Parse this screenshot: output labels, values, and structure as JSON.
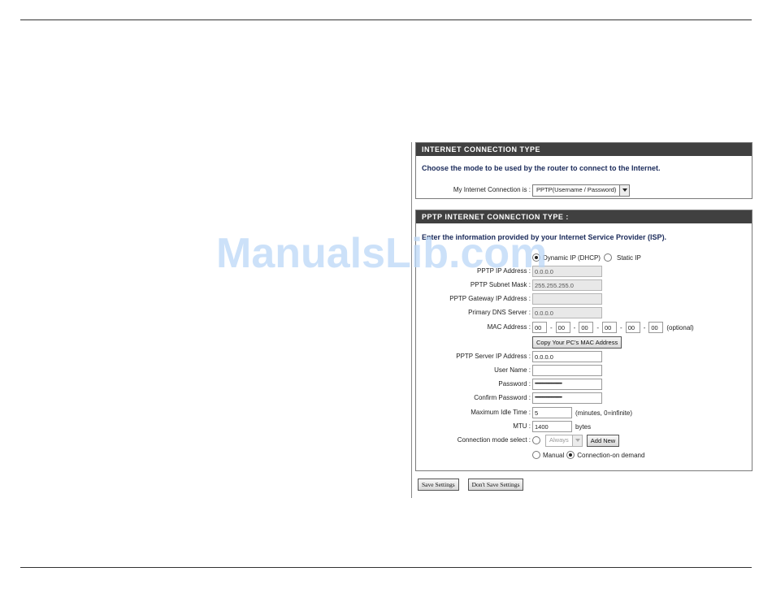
{
  "watermark": "ManualsLib.com",
  "connection_type": {
    "header": "INTERNET CONNECTION TYPE",
    "intro": "Choose the mode to be used by the router to connect to the Internet.",
    "label": "My Internet Connection is :",
    "selected": "PPTP(Username / Password)"
  },
  "pptp": {
    "header": "PPTP INTERNET CONNECTION TYPE :",
    "intro": "Enter the information provided by your Internet Service Provider (ISP).",
    "address_mode": {
      "dynamic_label": "Dynamic IP (DHCP)",
      "static_label": "Static IP",
      "selected": "dynamic"
    },
    "ip_address": {
      "label": "PPTP IP Address :",
      "value": "0.0.0.0"
    },
    "subnet_mask": {
      "label": "PPTP Subnet Mask :",
      "value": "255.255.255.0"
    },
    "gateway": {
      "label": "PPTP Gateway IP Address :",
      "value": ""
    },
    "dns": {
      "label": "Primary DNS Server :",
      "value": "0.0.0.0"
    },
    "mac": {
      "label": "MAC Address :",
      "octets": [
        "00",
        "00",
        "00",
        "00",
        "00",
        "00"
      ],
      "separator": "-",
      "optional": "(optional)",
      "copy_button": "Copy Your PC's MAC Address"
    },
    "server_ip": {
      "label": "PPTP Server IP Address :",
      "value": "0.0.0.0"
    },
    "username": {
      "label": "User Name :",
      "value": ""
    },
    "password": {
      "label": "Password :",
      "value": "••••••••••••••••••••••••••••••"
    },
    "confirm_password": {
      "label": "Confirm Password :",
      "value": "••••••••••••••••••••••••••••••"
    },
    "idle_time": {
      "label": "Maximum Idle Time :",
      "value": "5",
      "unit": "(minutes, 0=infinite)"
    },
    "mtu": {
      "label": "MTU :",
      "value": "1400",
      "unit": "bytes"
    },
    "connection_mode": {
      "label": "Connection mode select :",
      "schedule": "Always",
      "add_new": "Add New",
      "manual_label": "Manual",
      "on_demand_label": "Connection-on demand",
      "selected": "on_demand"
    }
  },
  "actions": {
    "save": "Save Settings",
    "dont_save": "Don't Save Settings"
  }
}
